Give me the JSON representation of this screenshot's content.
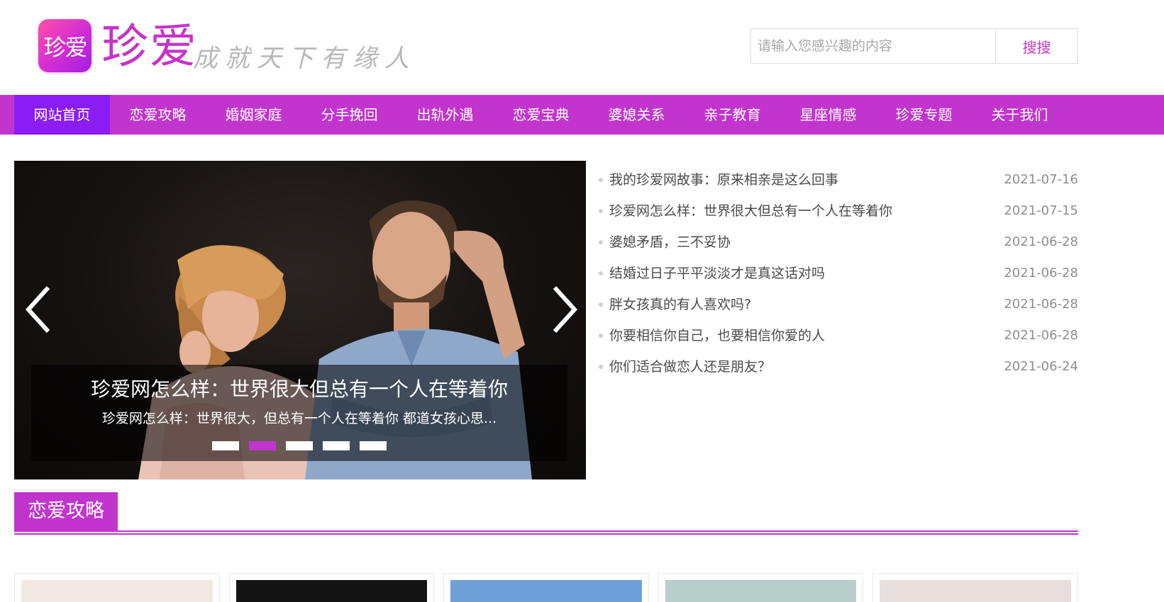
{
  "header": {
    "logo_badge_text": "珍爱",
    "logo_text": "珍爱",
    "slogan": "成就天下有缘人",
    "search_placeholder": "请输入您感兴趣的内容",
    "search_value": "",
    "search_button": "搜搜"
  },
  "colors": {
    "brand_purple": "#c135ce",
    "nav_active": "#8b1cf3",
    "logo_gradient": [
      "#ff4fa8",
      "#a21ee6"
    ]
  },
  "nav": {
    "items": [
      {
        "label": "网站首页",
        "active": true
      },
      {
        "label": "恋爱攻略"
      },
      {
        "label": "婚姻家庭"
      },
      {
        "label": "分手挽回"
      },
      {
        "label": "出轨外遇"
      },
      {
        "label": "恋爱宝典"
      },
      {
        "label": "婆媳关系"
      },
      {
        "label": "亲子教育"
      },
      {
        "label": "星座情感"
      },
      {
        "label": "珍爱专题"
      },
      {
        "label": "关于我们"
      }
    ]
  },
  "slider": {
    "caption_title": "珍爱网怎么样：世界很大但总有一个人在等着你",
    "caption_sub": "珍爱网怎么样：世界很大，但总有一个人在等着你 都道女孩心思...",
    "dots": 5,
    "active_dot": 2,
    "prev_icon": "chevron-left-icon",
    "next_icon": "chevron-right-icon"
  },
  "news": [
    {
      "title": "我的珍爱网故事：原来相亲是这么回事",
      "date": "2021-07-16"
    },
    {
      "title": "珍爱网怎么样：世界很大但总有一个人在等着你",
      "date": "2021-07-15"
    },
    {
      "title": "婆媳矛盾，三不妥协",
      "date": "2021-06-28"
    },
    {
      "title": "结婚过日子平平淡淡才是真这话对吗",
      "date": "2021-06-28"
    },
    {
      "title": "胖女孩真的有人喜欢吗?",
      "date": "2021-06-28"
    },
    {
      "title": "你要相信你自己，也要相信你爱的人",
      "date": "2021-06-28"
    },
    {
      "title": "你们适合做恋人还是朋友？",
      "date": "2021-06-24"
    }
  ],
  "section": {
    "title": "恋爱攻略"
  },
  "cards": [
    {
      "tone": "#efe9e2"
    },
    {
      "tone": "#141414"
    },
    {
      "tone": "#6f9fd8"
    },
    {
      "tone": "#b7cfca"
    },
    {
      "tone": "#e8dedc"
    }
  ]
}
